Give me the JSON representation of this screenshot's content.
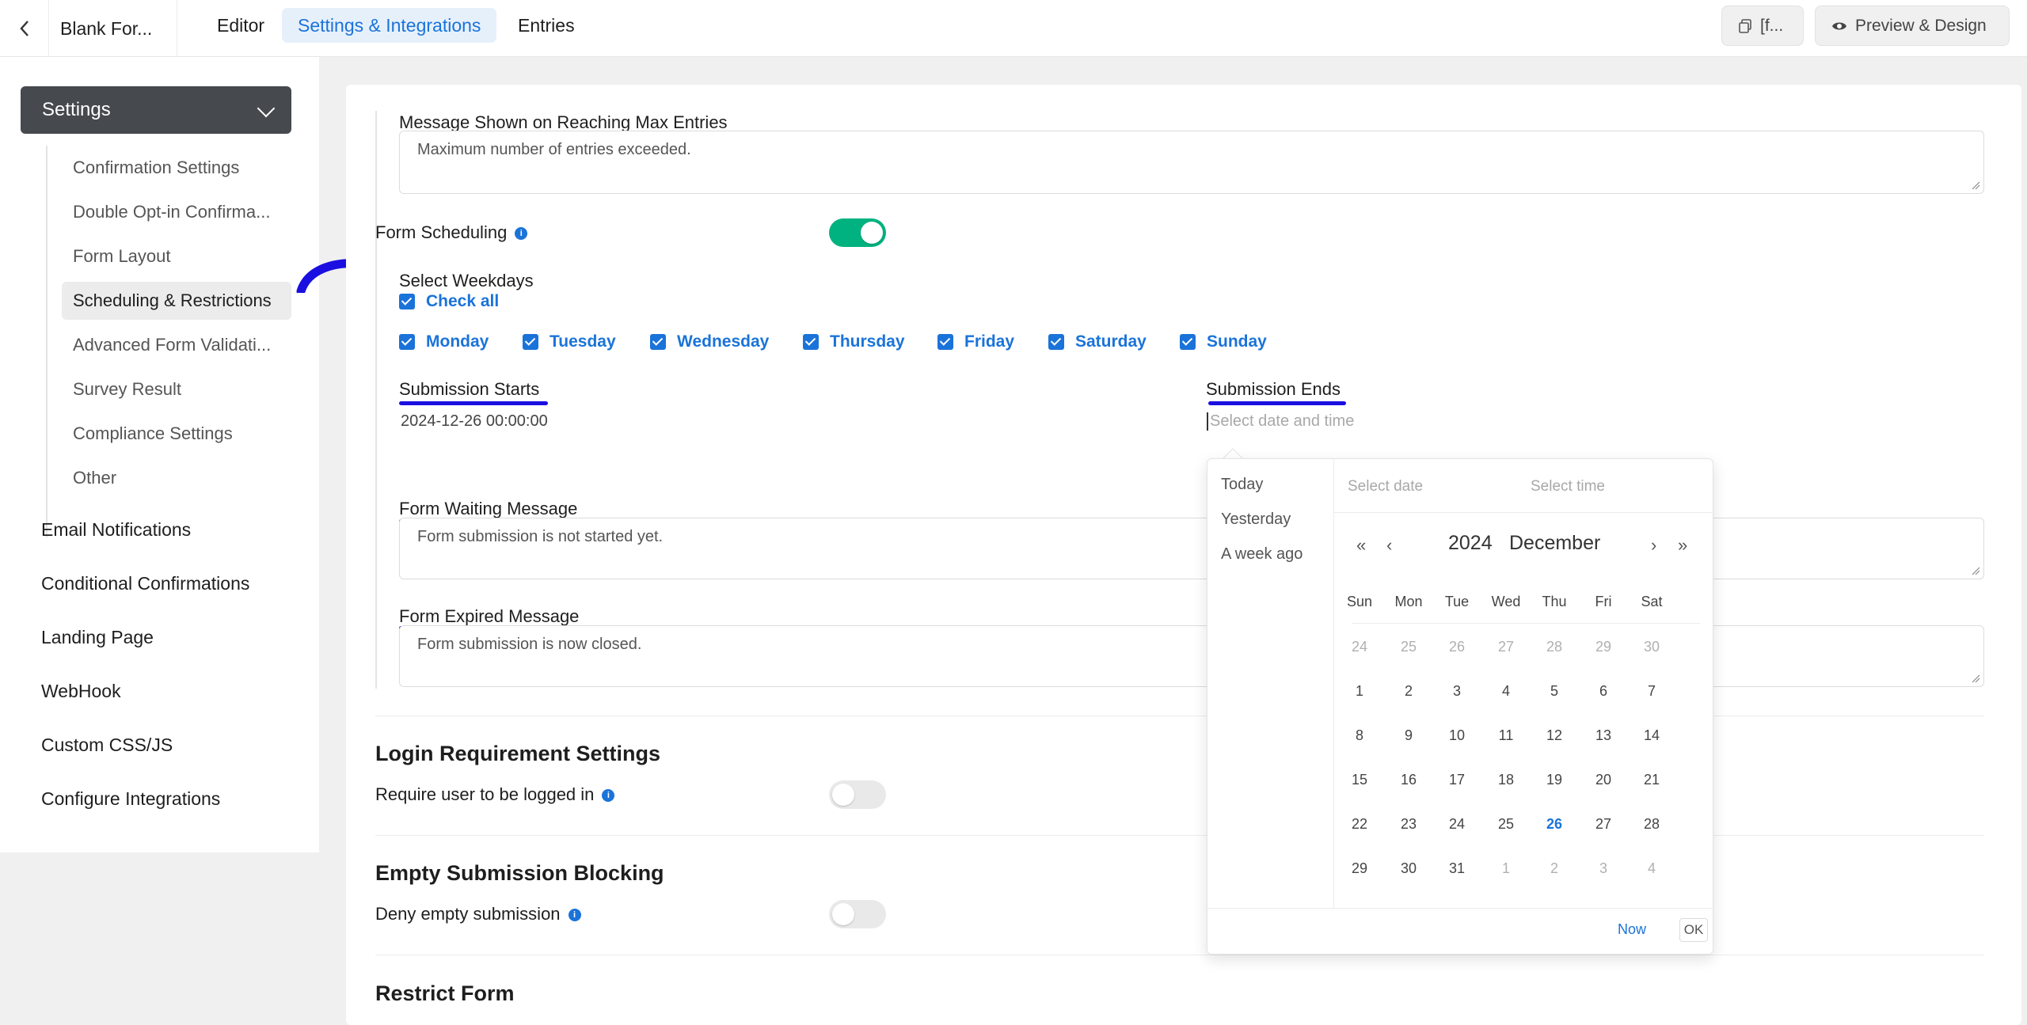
{
  "topbar": {
    "back_icon": "chevron-left-icon",
    "form_name": "Blank For...",
    "tabs": [
      {
        "label": "Editor",
        "active": false
      },
      {
        "label": "Settings & Integrations",
        "active": true
      },
      {
        "label": "Entries",
        "active": false
      }
    ],
    "shortcode_label": "[f...",
    "preview_label": "Preview & Design"
  },
  "sidebar": {
    "settings_label": "Settings",
    "sub_items": [
      {
        "label": "Confirmation Settings"
      },
      {
        "label": "Double Opt-in Confirma..."
      },
      {
        "label": "Form Layout"
      },
      {
        "label": "Scheduling & Restrictions",
        "active": true
      },
      {
        "label": "Advanced Form Validati..."
      },
      {
        "label": "Survey Result"
      },
      {
        "label": "Compliance Settings"
      },
      {
        "label": "Other"
      }
    ],
    "main_items": [
      {
        "label": "Email Notifications"
      },
      {
        "label": "Conditional Confirmations"
      },
      {
        "label": "Landing Page"
      },
      {
        "label": "WebHook"
      },
      {
        "label": "Custom CSS/JS"
      },
      {
        "label": "Configure Integrations"
      }
    ]
  },
  "content": {
    "max_entries_label": "Message Shown on Reaching Max Entries",
    "max_entries_value": "Maximum number of entries exceeded.",
    "form_scheduling_label": "Form Scheduling",
    "form_scheduling_on": true,
    "select_weekdays_label": "Select Weekdays",
    "check_all_label": "Check all",
    "weekdays": [
      "Monday",
      "Tuesday",
      "Wednesday",
      "Thursday",
      "Friday",
      "Saturday",
      "Sunday"
    ],
    "submission_starts_label": "Submission Starts",
    "submission_starts_value": "2024-12-26 00:00:00",
    "submission_ends_label": "Submission Ends",
    "submission_ends_placeholder": "Select date and time",
    "waiting_message_label": "Form Waiting Message",
    "waiting_message_value": "Form submission is not started yet.",
    "expired_message_label": "Form Expired Message",
    "expired_message_value": "Form submission is now closed.",
    "login_section_title": "Login Requirement Settings",
    "login_required_label": "Require user to be logged in",
    "login_required_on": false,
    "empty_section_title": "Empty Submission Blocking",
    "deny_empty_label": "Deny empty submission",
    "deny_empty_on": false,
    "restrict_section_title": "Restrict Form"
  },
  "datepicker": {
    "shortcuts": [
      "Today",
      "Yesterday",
      "A week ago"
    ],
    "date_placeholder": "Select date",
    "time_placeholder": "Select time",
    "year": "2024",
    "month": "December",
    "days_of_week": [
      "Sun",
      "Mon",
      "Tue",
      "Wed",
      "Thu",
      "Fri",
      "Sat"
    ],
    "weeks": [
      [
        "24",
        "25",
        "26",
        "27",
        "28",
        "29",
        "30"
      ],
      [
        "1",
        "2",
        "3",
        "4",
        "5",
        "6",
        "7"
      ],
      [
        "8",
        "9",
        "10",
        "11",
        "12",
        "13",
        "14"
      ],
      [
        "15",
        "16",
        "17",
        "18",
        "19",
        "20",
        "21"
      ],
      [
        "22",
        "23",
        "24",
        "25",
        "26",
        "27",
        "28"
      ],
      [
        "29",
        "30",
        "31",
        "1",
        "2",
        "3",
        "4"
      ]
    ],
    "today": "26",
    "now_label": "Now",
    "ok_label": "OK"
  },
  "colors": {
    "accent": "#1a73d9",
    "toggle_on": "#00b27f",
    "annotation": "#1a0fe0"
  }
}
